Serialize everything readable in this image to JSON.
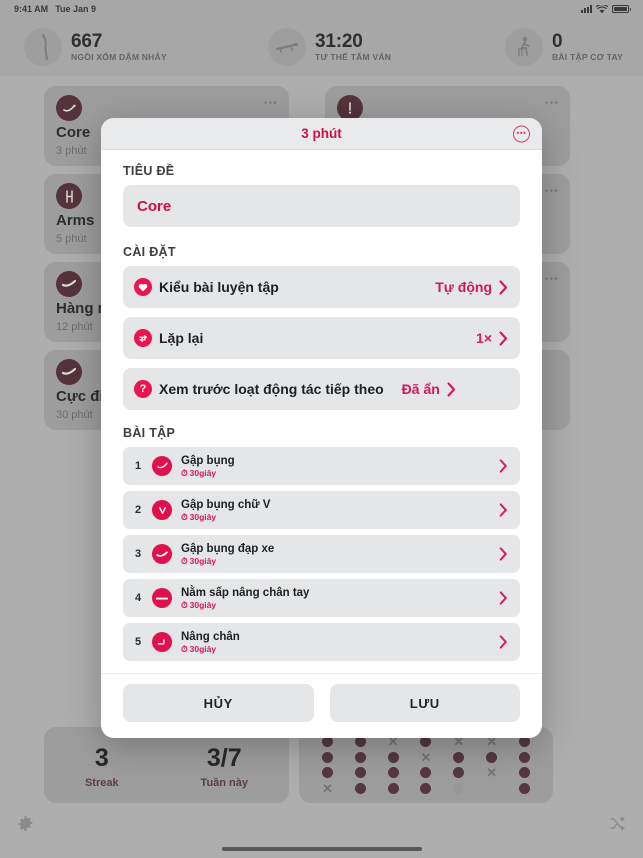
{
  "status_bar": {
    "time": "9:41 AM",
    "date": "Tue Jan 9",
    "signal_icon": "cellular-bars-icon",
    "wifi_icon": "wifi-icon",
    "battery_icon": "battery-full-icon"
  },
  "top_stats": [
    {
      "value": "667",
      "label": "NGỒI XỔM DẬM NHẢY",
      "icon": "squat-jump-icon"
    },
    {
      "value": "31:20",
      "label": "TƯ THẾ TẤM VÁN",
      "icon": "plank-icon"
    },
    {
      "value": "0",
      "label": "BÀI TẬP CƠ TAY",
      "icon": "arm-exercise-icon"
    }
  ],
  "workout_cards": {
    "left": [
      {
        "title": "Core",
        "duration": "3 phút",
        "icon": "crunch-icon"
      },
      {
        "title": "Arms",
        "duration": "5 phút",
        "icon": "arms-icon"
      },
      {
        "title": "Hàng n",
        "duration": "12 phút",
        "icon": "plank-icon"
      },
      {
        "title": "Cực đỉ",
        "duration": "30 phút",
        "icon": "plank-icon"
      }
    ],
    "right": [
      {
        "title": "",
        "duration": "",
        "icon": "more-icon"
      },
      {
        "title": "",
        "duration": "",
        "icon": "more-icon"
      },
      {
        "title": "",
        "duration": "",
        "icon": "more-icon"
      },
      {
        "title": "",
        "duration": "",
        "icon": ""
      }
    ],
    "menu_glyph": "•••"
  },
  "bottom": {
    "streak": {
      "value": "3",
      "label": "Streak"
    },
    "week": {
      "value": "3/7",
      "label": "Tuần này"
    },
    "history_grid": [
      [
        "dot",
        "dot",
        "x",
        "dot",
        "x",
        "x",
        "dot"
      ],
      [
        "dot",
        "dot",
        "dot",
        "x",
        "dot",
        "dot",
        "dot"
      ],
      [
        "dot",
        "dot",
        "dot",
        "dot",
        "dot",
        "x",
        "dot"
      ],
      [
        "x",
        "dot",
        "dot",
        "dot",
        "off",
        "none",
        "dot"
      ]
    ],
    "settings_icon": "gear-icon",
    "shuffle_icon": "shuffle-icon"
  },
  "modal": {
    "title": "3 phút",
    "more_glyph": "•••",
    "more_icon": "ellipsis-circle-icon",
    "title_section_label": "TIÊU ĐỀ",
    "title_value": "Core",
    "settings_section_label": "CÀI ĐẶT",
    "settings": [
      {
        "name": "Kiểu bài luyện tập",
        "value": "Tự động",
        "icon": "heart-icon",
        "glyph": "♥"
      },
      {
        "name": "Lặp lại",
        "value": "1×",
        "icon": "repeat-icon",
        "glyph": "⟳"
      },
      {
        "name": "Xem trước loạt động tác tiếp theo",
        "value": "Đã ẩn",
        "icon": "question-icon",
        "glyph": "?"
      }
    ],
    "exercises_section_label": "BÀI TẬP",
    "exercises": [
      {
        "num": "1",
        "name": "Gập bụng",
        "duration": "30giây",
        "icon": "crunch-icon"
      },
      {
        "num": "2",
        "name": "Gập bụng chữ V",
        "duration": "30giây",
        "icon": "v-up-icon"
      },
      {
        "num": "3",
        "name": "Gập bụng đạp xe",
        "duration": "30giây",
        "icon": "bicycle-crunch-icon"
      },
      {
        "num": "4",
        "name": "Nằm sấp nâng chân tay",
        "duration": "30giây",
        "icon": "superman-icon"
      },
      {
        "num": "5",
        "name": "Nâng chân",
        "duration": "30giây",
        "icon": "leg-raise-icon"
      }
    ],
    "timer_glyph": "⏱",
    "cancel_label": "HỦY",
    "save_label": "LƯU"
  },
  "colors": {
    "accent": "#d4185a",
    "accent_strong": "#e8154e",
    "card_bg": "#b5b6b7",
    "field_bg": "#e5e6e7",
    "page_bg": "#c9cacb"
  }
}
